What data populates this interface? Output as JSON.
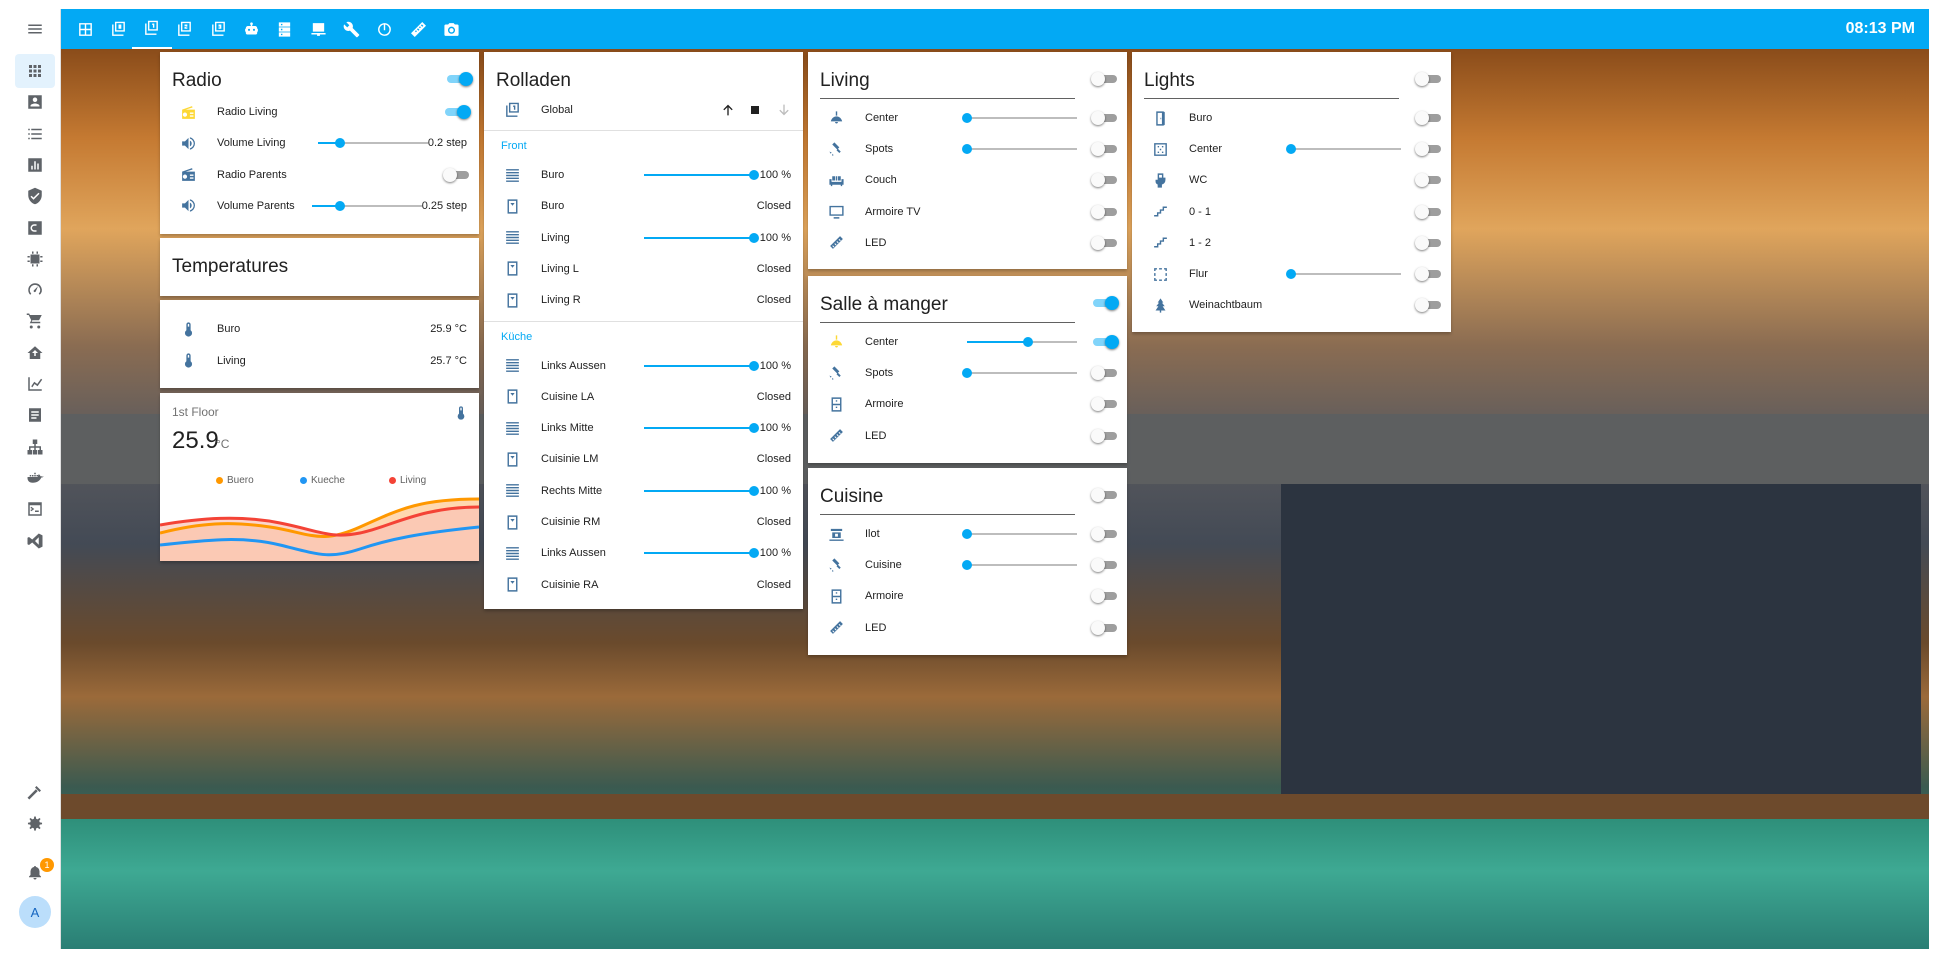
{
  "topbar": {
    "clock": "08:13 PM",
    "tabs": [
      "map-icon",
      "floor-0-icon",
      "floor-1-icon",
      "floor-2-icon",
      "floor-3-icon",
      "robot-icon",
      "server-icon",
      "desktop-icon",
      "wrench-icon",
      "power-icon",
      "ruler-icon",
      "camera-icon"
    ],
    "active_tab": 2
  },
  "sidebar": {
    "items": [
      "apps-icon",
      "account-box-icon",
      "list-icon",
      "chart-bar-icon",
      "shield-icon",
      "c-box-icon",
      "chip-icon",
      "speedometer-icon",
      "cart-icon",
      "home-import-icon",
      "chart-line-icon",
      "text-box-icon",
      "sitemap-icon",
      "docker-icon",
      "console-icon",
      "vscode-icon"
    ],
    "bottom": [
      "hammer-icon",
      "settings-icon"
    ],
    "notifications": "1",
    "avatar": "A"
  },
  "radio": {
    "title": "Radio",
    "header_on": true,
    "rows": [
      {
        "icon": "radio-icon",
        "label": "Radio Living",
        "type": "toggle",
        "on": true
      },
      {
        "icon": "volume-icon",
        "label": "Volume Living",
        "type": "slider",
        "value": 0.2,
        "display": "0.2 step"
      },
      {
        "icon": "radio-icon",
        "label": "Radio Parents",
        "type": "toggle",
        "on": false
      },
      {
        "icon": "volume-icon",
        "label": "Volume Parents",
        "type": "slider",
        "value": 0.25,
        "display": "0.25 step"
      }
    ]
  },
  "temperatures": {
    "title": "Temperatures",
    "rows": [
      {
        "icon": "thermometer-icon",
        "label": "Buro",
        "value": "25.9 °C"
      },
      {
        "icon": "thermometer-icon",
        "label": "Living",
        "value": "25.7 °C"
      }
    ]
  },
  "floor": {
    "title": "1st Floor",
    "value": "25.9",
    "unit": "°C",
    "legend": [
      {
        "name": "Buero",
        "color": "#ff9800"
      },
      {
        "name": "Kueche",
        "color": "#2196f3"
      },
      {
        "name": "Living",
        "color": "#f44336"
      }
    ]
  },
  "rolladen": {
    "title": "Rolladen",
    "global_label": "Global",
    "sections": [
      {
        "label": "Front",
        "rows": [
          {
            "icon": "blinds-icon",
            "label": "Buro",
            "type": "slider",
            "value": 100,
            "display": "100 %"
          },
          {
            "icon": "window-icon",
            "label": "Buro",
            "type": "state",
            "display": "Closed"
          },
          {
            "icon": "blinds-icon",
            "label": "Living",
            "type": "slider",
            "value": 100,
            "display": "100 %"
          },
          {
            "icon": "window-icon",
            "label": "Living L",
            "type": "state",
            "display": "Closed"
          },
          {
            "icon": "window-icon",
            "label": "Living R",
            "type": "state",
            "display": "Closed"
          }
        ]
      },
      {
        "label": "Küche",
        "rows": [
          {
            "icon": "blinds-icon",
            "label": "Links Aussen",
            "type": "slider",
            "value": 100,
            "display": "100 %"
          },
          {
            "icon": "window-icon",
            "label": "Cuisine LA",
            "type": "state",
            "display": "Closed"
          },
          {
            "icon": "blinds-icon",
            "label": "Links Mitte",
            "type": "slider",
            "value": 100,
            "display": "100 %"
          },
          {
            "icon": "window-icon",
            "label": "Cuisinie LM",
            "type": "state",
            "display": "Closed"
          },
          {
            "icon": "blinds-icon",
            "label": "Rechts Mitte",
            "type": "slider",
            "value": 100,
            "display": "100 %"
          },
          {
            "icon": "window-icon",
            "label": "Cuisinie RM",
            "type": "state",
            "display": "Closed"
          },
          {
            "icon": "blinds-icon",
            "label": "Links Aussen",
            "type": "slider",
            "value": 100,
            "display": "100 %"
          },
          {
            "icon": "window-icon",
            "label": "Cuisinie RA",
            "type": "state",
            "display": "Closed"
          }
        ]
      }
    ]
  },
  "living": {
    "title": "Living",
    "header_on": false,
    "rows": [
      {
        "icon": "ceiling-light-icon",
        "label": "Center",
        "slider": 0,
        "on": false
      },
      {
        "icon": "spotlight-icon",
        "label": "Spots",
        "slider": 0,
        "on": false
      },
      {
        "icon": "sofa-icon",
        "label": "Couch",
        "on": false
      },
      {
        "icon": "television-icon",
        "label": "Armoire TV",
        "on": false
      },
      {
        "icon": "led-strip-icon",
        "label": "LED",
        "on": false
      }
    ]
  },
  "salle": {
    "title": "Salle à manger",
    "header_on": true,
    "rows": [
      {
        "icon": "ceiling-light-icon",
        "label": "Center",
        "slider": 0.55,
        "on": true,
        "color": "#fdd835"
      },
      {
        "icon": "spotlight-icon",
        "label": "Spots",
        "slider": 0,
        "on": false
      },
      {
        "icon": "wardrobe-icon",
        "label": "Armoire",
        "on": false
      },
      {
        "icon": "led-strip-icon",
        "label": "LED",
        "on": false
      }
    ]
  },
  "cuisine": {
    "title": "Cuisine",
    "header_on": false,
    "rows": [
      {
        "icon": "light-island-icon",
        "label": "Ilot",
        "slider": 0,
        "on": false
      },
      {
        "icon": "spotlight-icon",
        "label": "Cuisine",
        "slider": 0,
        "on": false
      },
      {
        "icon": "wardrobe-icon",
        "label": "Armoire",
        "on": false
      },
      {
        "icon": "led-strip-icon",
        "label": "LED",
        "on": false
      }
    ]
  },
  "lights": {
    "title": "Lights",
    "header_on": false,
    "rows": [
      {
        "icon": "door-icon",
        "label": "Buro",
        "on": false
      },
      {
        "icon": "panel-light-icon",
        "label": "Center",
        "slider": 0,
        "on": false
      },
      {
        "icon": "toilet-icon",
        "label": "WC",
        "on": false
      },
      {
        "icon": "stairs-icon",
        "label": "0 - 1",
        "on": false
      },
      {
        "icon": "stairs-icon",
        "label": "1 - 2",
        "on": false
      },
      {
        "icon": "floor-light-icon",
        "label": "Flur",
        "slider": 0,
        "on": false
      },
      {
        "icon": "tree-icon",
        "label": "Weinachtbaum",
        "on": false
      }
    ]
  }
}
